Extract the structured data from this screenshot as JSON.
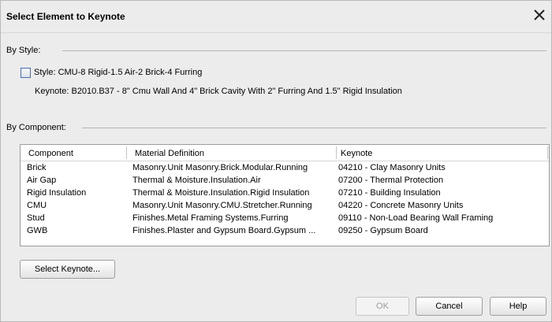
{
  "dialog": {
    "title": "Select Element to Keynote"
  },
  "by_style": {
    "label": "By Style:",
    "checkbox_label": "Style: CMU-8 Rigid-1.5 Air-2 Brick-4 Furring",
    "checked": false,
    "keynote": "Keynote: B2010.B37 - 8\" Cmu Wall And 4\" Brick Cavity With 2\" Furring And 1.5\" Rigid Insulation"
  },
  "by_component": {
    "label": "By Component:",
    "columns": [
      "Component",
      "Material Definition",
      "Keynote"
    ],
    "rows": [
      {
        "component": "Brick",
        "material": "Masonry.Unit Masonry.Brick.Modular.Running",
        "keynote": "04210 - Clay Masonry Units"
      },
      {
        "component": "Air Gap",
        "material": "Thermal & Moisture.Insulation.Air",
        "keynote": "07200 - Thermal Protection"
      },
      {
        "component": "Rigid Insulation",
        "material": "Thermal & Moisture.Insulation.Rigid Insulation",
        "keynote": "07210 - Building Insulation"
      },
      {
        "component": "CMU",
        "material": "Masonry.Unit Masonry.CMU.Stretcher.Running",
        "keynote": "04220 - Concrete Masonry Units"
      },
      {
        "component": "Stud",
        "material": "Finishes.Metal Framing Systems.Furring",
        "keynote": "09110 - Non-Load Bearing Wall Framing"
      },
      {
        "component": "GWB",
        "material": "Finishes.Plaster and Gypsum Board.Gypsum ...",
        "keynote": "09250 - Gypsum Board"
      }
    ]
  },
  "buttons": {
    "select_keynote": "Select Keynote...",
    "ok": "OK",
    "cancel": "Cancel",
    "help": "Help"
  }
}
